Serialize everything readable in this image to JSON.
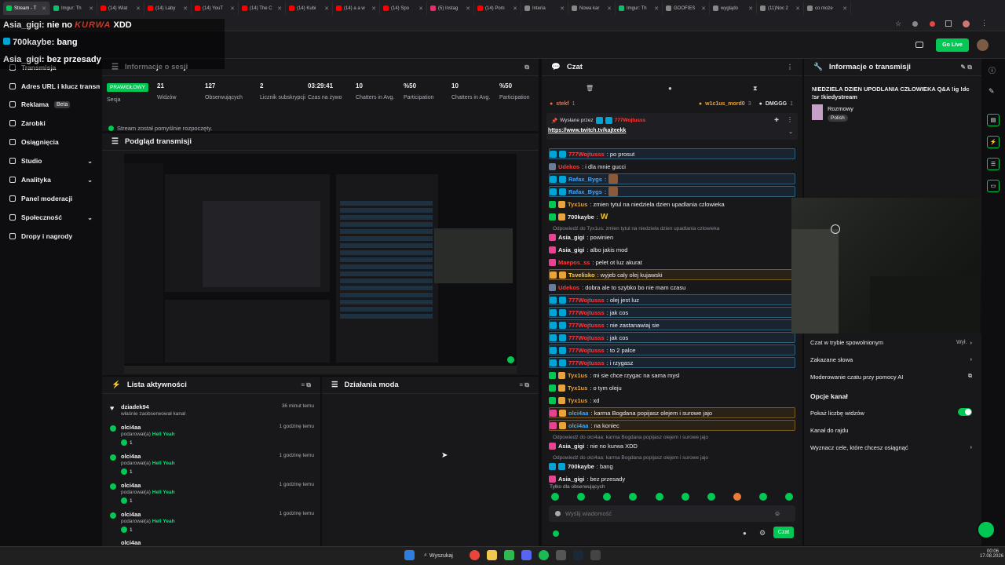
{
  "browser": {
    "tabs": [
      {
        "label": "Stream - T",
        "color": "#00c853",
        "active": true
      },
      {
        "label": "Imgur: Th",
        "color": "#1bb76e"
      },
      {
        "label": "(14) Wiat",
        "color": "#ff0000"
      },
      {
        "label": "(14) Laby",
        "color": "#ff0000"
      },
      {
        "label": "(14) YouT",
        "color": "#ff0000"
      },
      {
        "label": "(14) The C",
        "color": "#ff0000"
      },
      {
        "label": "(14) Kubi",
        "color": "#ff0000"
      },
      {
        "label": "(14) a a w",
        "color": "#ff0000"
      },
      {
        "label": "(14) Spo",
        "color": "#ff0000"
      },
      {
        "label": "(5) Instag",
        "color": "#e1306c"
      },
      {
        "label": "(14) Pom",
        "color": "#ff0000"
      },
      {
        "label": "Interia",
        "color": "#888888"
      },
      {
        "label": "Nowa kar",
        "color": "#888888"
      },
      {
        "label": "Imgur: Th",
        "color": "#1bb76e"
      },
      {
        "label": "GOOFIES",
        "color": "#888888"
      },
      {
        "label": "wyglądo",
        "color": "#888888"
      },
      {
        "label": "(11)Noc 2",
        "color": "#888888"
      },
      {
        "label": "co może",
        "color": "#888888"
      }
    ]
  },
  "overlay": {
    "line1_user": "Asia_gigi",
    "line1_text": ": nie no",
    "line1_censored": "KURWA",
    "line1_end": "XDD",
    "line2_user": "700kaybe",
    "line2_text": ": bang",
    "line3_user": "Asia_gigi",
    "line3_text": ": bez przesady"
  },
  "header": {
    "golive": "Go Live"
  },
  "nav": {
    "items": [
      {
        "label": "Transmisja"
      },
      {
        "label": "Adres URL i klucz transmisji"
      },
      {
        "label": "Reklama",
        "badge": "Beta"
      },
      {
        "label": "Zarobki"
      },
      {
        "label": "Osiągnięcia"
      },
      {
        "label": "Studio",
        "chev": "⌄"
      },
      {
        "label": "Analityka",
        "chev": "⌄"
      },
      {
        "label": "Panel moderacji"
      },
      {
        "label": "Społeczność",
        "chev": "⌄"
      },
      {
        "label": "Dropy i nagrody"
      }
    ]
  },
  "session": {
    "title": "Informacje o sesji",
    "live_badge": "PRAWIDŁOWY",
    "session_label": "Sesja",
    "stats": [
      {
        "value": "21",
        "label": "Widzów"
      },
      {
        "value": "127",
        "label": "Obserwujących"
      },
      {
        "value": "2",
        "label": "Licznik subskrypcji"
      },
      {
        "value": "03:29:41",
        "label": "Czas na żywo"
      },
      {
        "value": "10",
        "label": "Chatters in Avg."
      },
      {
        "value": "%50",
        "label": "Participation"
      },
      {
        "value": "10",
        "label": "Chatters in Avg."
      },
      {
        "value": "%50",
        "label": "Participation"
      }
    ],
    "success": "Stream został pomyślnie rozpoczęty."
  },
  "preview": {
    "title": "Podgląd transmisji"
  },
  "activity": {
    "title": "Lista aktywności",
    "items": [
      {
        "name": "dziadek94",
        "desc": "właśnie zaobserwował kanał",
        "time": "36 minut temu",
        "gift": "",
        "count": ""
      },
      {
        "name": "olci4aa",
        "desc": "podarował(a)",
        "gift": "Hell Yeah",
        "time": "1 godzinę temu",
        "count": "1"
      },
      {
        "name": "olci4aa",
        "desc": "podarował(a)",
        "gift": "Hell Yeah",
        "time": "1 godzinę temu",
        "count": "1"
      },
      {
        "name": "olci4aa",
        "desc": "podarował(a)",
        "gift": "Hell Yeah",
        "time": "1 godzinę temu",
        "count": "1"
      },
      {
        "name": "olci4aa",
        "desc": "podarował(a)",
        "gift": "Hell Yeah",
        "time": "1 godzinę temu",
        "count": "1"
      }
    ],
    "cut": "olci4aa"
  },
  "modactions": {
    "title": "Działania moda"
  },
  "chat": {
    "title": "Czat",
    "top_users": [
      {
        "name": "stekf",
        "count": "1",
        "color": "#ff6a3d"
      },
      {
        "name": "w1c1us_mord0",
        "count": "3",
        "color": "#e8a33a"
      },
      {
        "name": "DMGGG",
        "count": "1",
        "color": "#dedee3"
      }
    ],
    "pinned_by_label": "Wysłane przez",
    "pinned_by_user": "777Wojtusss",
    "pinned_link": "https://www.twitch.tv/kajteekk",
    "messages": [
      {
        "user": "777Wojtusss",
        "color": "#ff3b3b",
        "text": ": po prosut",
        "style": "hl",
        "badges": [
          "#00a5d6",
          "#00a5d6"
        ]
      },
      {
        "user": "Udekos",
        "color": "#ff3b3b",
        "text": ": i dla mnie gucci",
        "style": "",
        "badges": [
          "#6b7b9c"
        ]
      },
      {
        "user": "Rafax_Bygs",
        "color": "#3ea6ff",
        "text": ":",
        "emote": true,
        "style": "hl",
        "badges": [
          "#00a5d6",
          "#00a5d6"
        ]
      },
      {
        "user": "Rafax_Bygs",
        "color": "#3ea6ff",
        "text": ":",
        "emote": true,
        "style": "hl",
        "badges": [
          "#00a5d6",
          "#00a5d6"
        ]
      },
      {
        "user": "Tyx1us",
        "color": "#e8a33a",
        "text": ": zmien tytul na niedziela dzien upadlania czlowieka",
        "style": "",
        "badges": [
          "#00c853",
          "#e8a33a"
        ]
      },
      {
        "user": "700kaybe",
        "color": "#efeff1",
        "text": ":",
        "emoteText": "W",
        "style": "",
        "badges": [
          "#00c853",
          "#e8a33a"
        ]
      },
      {
        "reply": "Odpowiedź do Tyx1us: zmien tytul na niedziela dzien upadlania czlowieka"
      },
      {
        "user": "Asia_gigi",
        "color": "#efeff1",
        "text": ": powinien",
        "style": "",
        "badges": [
          "#e84393"
        ]
      },
      {
        "user": "Asia_gigi",
        "color": "#efeff1",
        "text": ": albo jakis mod",
        "style": "",
        "badges": [
          "#e84393"
        ]
      },
      {
        "user": "Maepos_ss",
        "color": "#ff3b3b",
        "text": ": pelet ot luz akurat",
        "style": "",
        "badges": [
          "#e84393"
        ]
      },
      {
        "user": "Tsvelisko",
        "color": "#ffd23f",
        "text": ": wyjeb caly olej kujawski",
        "style": "hly",
        "badges": [
          "#e8a33a",
          "#e8a33a"
        ]
      },
      {
        "user": "Udekos",
        "color": "#ff3b3b",
        "text": ": dobra ale to szybko bo nie mam czasu",
        "style": "",
        "badges": [
          "#6b7b9c"
        ]
      },
      {
        "user": "777Wojtusss",
        "color": "#ff3b3b",
        "text": ": olej jest luz",
        "style": "hl",
        "badges": [
          "#00a5d6",
          "#00a5d6"
        ]
      },
      {
        "user": "777Wojtusss",
        "color": "#ff3b3b",
        "text": ": jak cos",
        "style": "hl",
        "badges": [
          "#00a5d6",
          "#00a5d6"
        ]
      },
      {
        "user": "777Wojtusss",
        "color": "#ff3b3b",
        "text": ": nie zastanawiaj sie",
        "style": "hl",
        "badges": [
          "#00a5d6",
          "#00a5d6"
        ]
      },
      {
        "user": "777Wojtusss",
        "color": "#ff3b3b",
        "text": ": jak cos",
        "style": "hl",
        "badges": [
          "#00a5d6",
          "#00a5d6"
        ]
      },
      {
        "user": "777Wojtusss",
        "color": "#ff3b3b",
        "text": ": to 2 palce",
        "style": "hl",
        "badges": [
          "#00a5d6",
          "#00a5d6"
        ]
      },
      {
        "user": "777Wojtusss",
        "color": "#ff3b3b",
        "text": ": i rzygasz",
        "style": "hl",
        "badges": [
          "#00a5d6",
          "#00a5d6"
        ]
      },
      {
        "user": "Tyx1us",
        "color": "#e8a33a",
        "text": ": mi sie chce rzygac na sama mysl",
        "style": "",
        "badges": [
          "#00c853",
          "#e8a33a"
        ]
      },
      {
        "user": "Tyx1us",
        "color": "#e8a33a",
        "text": ": o tym oleju",
        "style": "",
        "badges": [
          "#00c853",
          "#e8a33a"
        ]
      },
      {
        "user": "Tyx1us",
        "color": "#e8a33a",
        "text": ": xd",
        "style": "",
        "badges": [
          "#00c853",
          "#e8a33a"
        ]
      },
      {
        "user": "olci4aa",
        "color": "#3ea6ff",
        "text": ": karma Bogdana popijasz olejem i surowe jajo",
        "style": "hly",
        "badges": [
          "#e84393",
          "#e8a33a"
        ]
      },
      {
        "user": "olci4aa",
        "color": "#3ea6ff",
        "text": ": na koniec",
        "style": "hly",
        "badges": [
          "#e84393",
          "#e8a33a"
        ]
      },
      {
        "reply": "Odpowiedź do olci4aa: karma Bogdana popijasz olejem i surowe jajo"
      },
      {
        "user": "Asia_gigi",
        "color": "#efeff1",
        "text": ": nie no kurwa XDD",
        "style": "",
        "badges": [
          "#e84393"
        ]
      },
      {
        "reply": "Odpowiedź do olci4aa: karma Bogdana popijasz olejem i surowe jajo"
      },
      {
        "user": "700kaybe",
        "color": "#efeff1",
        "text": ": bang",
        "style": "",
        "badges": [
          "#00a5d6",
          "#00a5d6"
        ]
      },
      {
        "user": "Asia_gigi",
        "color": "#efeff1",
        "text": ": bez przesady",
        "style": "",
        "badges": [
          "#e84393"
        ]
      }
    ],
    "followers_only": "Tylko dla obserwujących",
    "input_placeholder": "Wyślij wiadomość",
    "send_label": "Czat"
  },
  "streaminfo": {
    "title": "Informacje o transmisji",
    "stream_title": "NIEDZIELA DZIEN UPODLANIA CZŁOWIEKA Q&A !ig !dc !sr !kiedystream",
    "category": "Rozmowy",
    "language": "Polish",
    "settings": [
      {
        "label": "Czat w trybie spowolnionym",
        "value": "Wył.",
        "arrow": "›"
      },
      {
        "label": "Zakazane słowa",
        "value": "",
        "arrow": "›"
      },
      {
        "label": "Moderowanie czatu przy pomocy AI",
        "value": "",
        "arrow": "⧉"
      }
    ],
    "channel_options_title": "Opcje kanał",
    "channel_settings": [
      {
        "label": "Pokaż liczbę widzów",
        "value": "",
        "arrow": ""
      },
      {
        "label": "Kanał do rajdu",
        "value": "",
        "arrow": ""
      },
      {
        "label": "Wyznacz cele, które chcesz osiągnąć",
        "value": "",
        "arrow": "›"
      }
    ]
  },
  "taskbar": {
    "search": "Wyszukaj",
    "time": "00:06",
    "date": "17.08.2026"
  }
}
